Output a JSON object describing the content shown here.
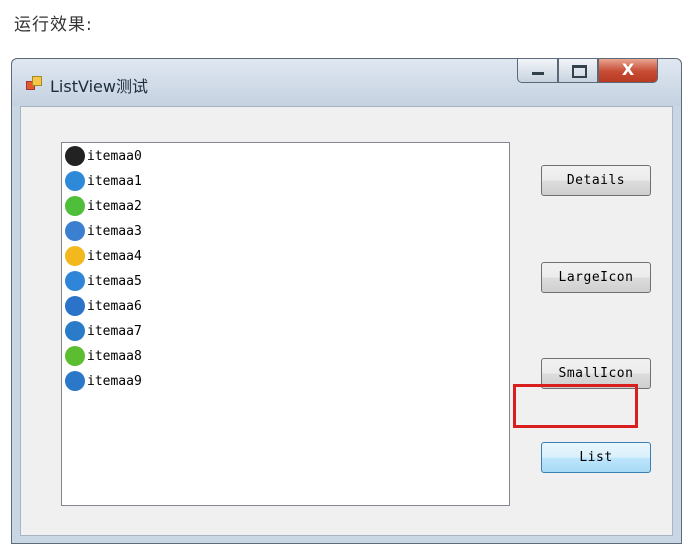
{
  "caption": "运行效果:",
  "window": {
    "title": "ListView测试",
    "close_glyph": "X"
  },
  "listview": {
    "items": [
      {
        "label": "itemaa0",
        "icon": "qq-penguin-icon",
        "color": "#222222"
      },
      {
        "label": "itemaa1",
        "icon": "qq-blue-icon",
        "color": "#2e8ad8"
      },
      {
        "label": "itemaa2",
        "icon": "qq-green-icon",
        "color": "#4fbf3a"
      },
      {
        "label": "itemaa3",
        "icon": "qq-blue-icon",
        "color": "#3a7fd0"
      },
      {
        "label": "itemaa4",
        "icon": "qq-yellow-icon",
        "color": "#f2b81d"
      },
      {
        "label": "itemaa5",
        "icon": "qq-blue-icon",
        "color": "#2f86d8"
      },
      {
        "label": "itemaa6",
        "icon": "qq-star-icon",
        "color": "#2b73c9"
      },
      {
        "label": "itemaa7",
        "icon": "qq-blue-icon",
        "color": "#2a7cc9"
      },
      {
        "label": "itemaa8",
        "icon": "qq-green-icon",
        "color": "#5bbd2f"
      },
      {
        "label": "itemaa9",
        "icon": "qq-search-icon",
        "color": "#2b78c8"
      }
    ]
  },
  "buttons": {
    "details": "Details",
    "large_icon": "LargeIcon",
    "small_icon": "SmallIcon",
    "list": "List"
  },
  "colors": {
    "highlight": "#d81e1e"
  }
}
